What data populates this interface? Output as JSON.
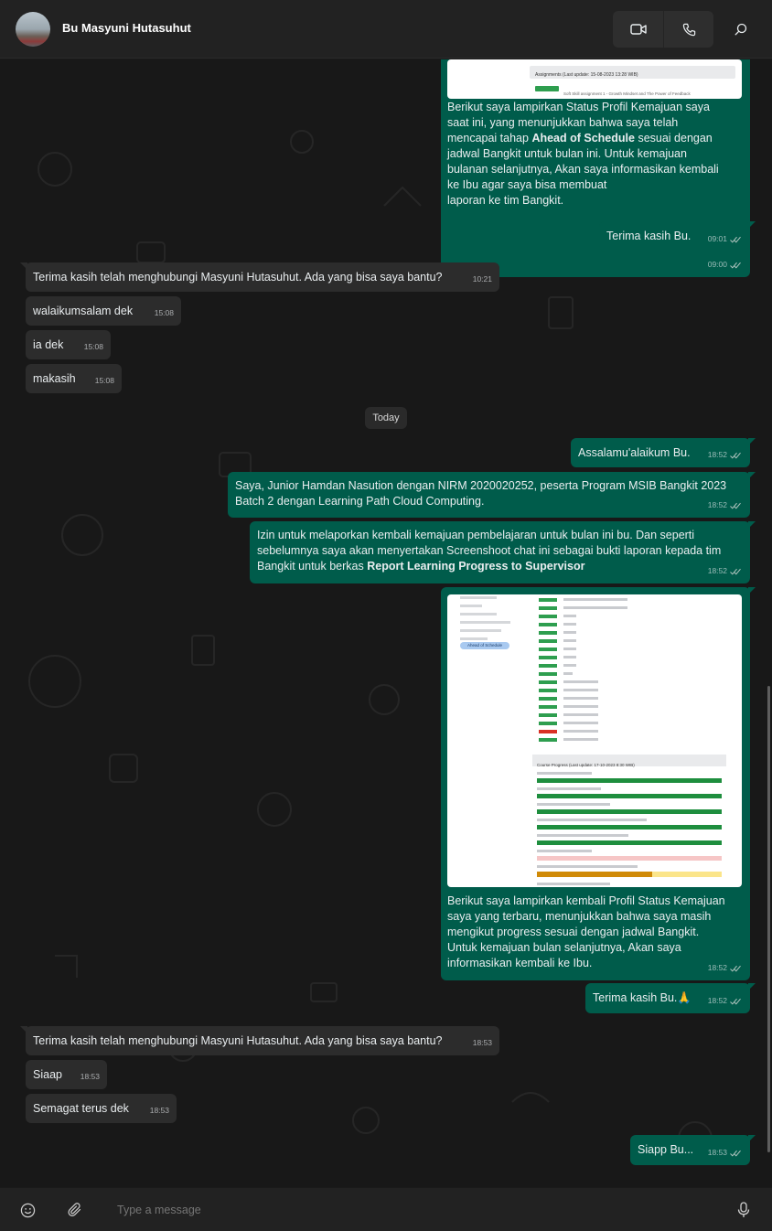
{
  "header": {
    "contact_name": "Bu Masyuni Hutasuhut",
    "icons": [
      "video-call-icon",
      "voice-call-icon",
      "search-icon"
    ]
  },
  "colors": {
    "outgoing_bubble": "#005c4b",
    "incoming_bubble": "#2c2c2c",
    "background": "#181818"
  },
  "messages": [
    {
      "dir": "out",
      "type": "image",
      "image_text": "Assignments (Last update: 15-08-2023 13:28 WIB)",
      "image_line": "Soft Skill assignment 1 - Growth Mindset and The Power of Feedback",
      "badge": "Completed",
      "lines": [
        "Berikut saya lampirkan Status Profil Kemajuan saya",
        "saat ini, yang menunjukkan bahwa saya telah",
        "mencapai tahap ",
        "Ahead of Schedule",
        " sesuai dengan",
        "jadwal Bangkit untuk bulan ini. Untuk kemajuan",
        "bulanan selanjutnya, Akan saya informasikan kembali",
        "ke Ibu agar saya bisa membuat",
        "laporan ke tim Bangkit."
      ],
      "time": "09:00"
    },
    {
      "dir": "out",
      "text": "Terima kasih Bu.",
      "time": "09:01"
    },
    {
      "dir": "in",
      "text": "Terima kasih telah menghubungi Masyuni Hutasuhut. Ada yang bisa saya bantu?",
      "time": "10:21"
    },
    {
      "dir": "in",
      "text": "walaikumsalam dek",
      "time": "15:08"
    },
    {
      "dir": "in",
      "text": "ia dek",
      "time": "15:08"
    },
    {
      "dir": "in",
      "text": "makasih",
      "time": "15:08"
    },
    {
      "dir": "out",
      "text": "Assalamu'alaikum Bu.",
      "time": "18:52"
    },
    {
      "dir": "out",
      "lines": [
        "Saya, Junior Hamdan Nasution dengan NIRM 2020020252, peserta Program MSIB Bangkit 2023",
        "Batch 2 dengan Learning Path Cloud Computing."
      ],
      "time": "18:52"
    },
    {
      "dir": "out",
      "lines": [
        "Izin untuk melaporkan kembali kemajuan pembelajaran untuk bulan ini bu. Dan seperti",
        "sebelumnya saya akan menyertakan Screenshoot chat ini sebagai bukti laporan kepada tim",
        "Bangkit untuk berkas ",
        "Report Learning Progress to Supervisor"
      ],
      "time": "18:52"
    },
    {
      "dir": "out",
      "type": "image",
      "image_title": "Course Progress (Last update: 17-10-2023 8:30 WIB)",
      "image_status": "Ahead of Schedule",
      "lines": [
        "Berikut saya lampirkan kembali Profil Status Kemajuan",
        "saya yang terbaru, menunjukkan bahwa saya masih",
        "mengikut progress sesuai dengan jadwal Bangkit.",
        "Untuk kemajuan bulan selanjutnya, Akan saya",
        "informasikan kembali ke Ibu."
      ],
      "time": "18:52"
    },
    {
      "dir": "out",
      "text": "Terima kasih Bu.🙏",
      "time": "18:52"
    },
    {
      "dir": "in",
      "text": "Terima kasih telah menghubungi Masyuni Hutasuhut. Ada yang bisa saya bantu?",
      "time": "18:53"
    },
    {
      "dir": "in",
      "text": "Siaap",
      "time": "18:53"
    },
    {
      "dir": "in",
      "text": "Semagat terus dek",
      "time": "18:53"
    },
    {
      "dir": "out",
      "text": "Siapp Bu...",
      "time": "18:53"
    }
  ],
  "day_separator": "Today",
  "composer": {
    "placeholder": "Type a message",
    "icons": [
      "emoji-icon",
      "attach-icon",
      "mic-icon"
    ]
  }
}
